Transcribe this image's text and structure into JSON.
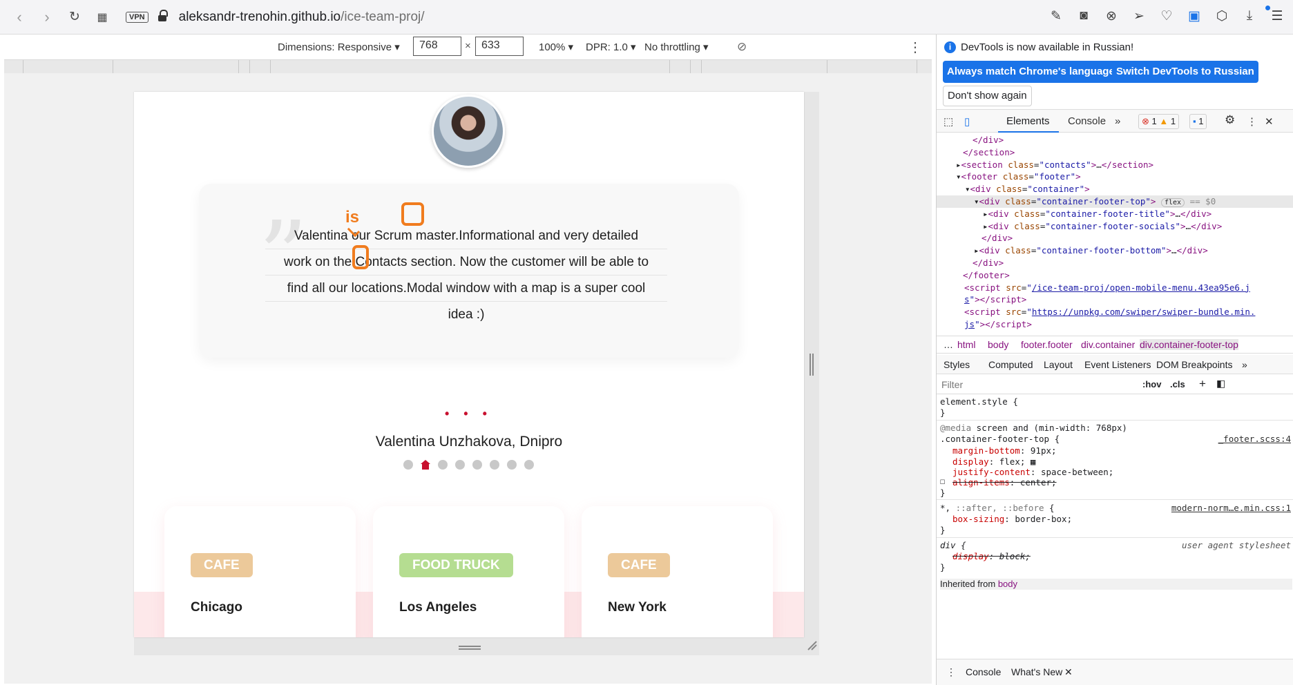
{
  "browser": {
    "vpn_label": "VPN",
    "url_domain": "aleksandr-trenohin.github.io",
    "url_path": "/ice-team-proj/"
  },
  "device_toolbar": {
    "dimensions": "Dimensions: Responsive ▾",
    "width": "768",
    "times": "×",
    "height": "633",
    "zoom": "100% ▾",
    "dpr": "DPR: 1.0 ▾",
    "throttling": "No throttling ▾"
  },
  "page": {
    "review_lines": [
      "Valentina our Scrum master.Informational and very detailed",
      "work on the Contacts section. Now the customer will be able to",
      "find all our locations.Modal window with a map is a super cool",
      "idea :)"
    ],
    "annotation": "is",
    "dots": "• • •",
    "author": "Valentina Unzhakova, Dnipro",
    "cards": [
      {
        "tag": "CAFE",
        "tag_color": "#ecc99a",
        "city": "Chicago"
      },
      {
        "tag": "FOOD TRUCK",
        "tag_color": "#b5dd91",
        "city": "Los Angeles"
      },
      {
        "tag": "CAFE",
        "tag_color": "#ecc99a",
        "city": "New York"
      }
    ]
  },
  "devtools": {
    "info_text": "DevTools is now available in Russian!",
    "btn_match": "Always match Chrome's language",
    "btn_switch": "Switch DevTools to Russian",
    "btn_dont_show": "Don't show again",
    "tab_elements": "Elements",
    "tab_console": "Console",
    "errors": "1",
    "warnings": "1",
    "messages": "1",
    "flex_badge": "flex",
    "dom_eq": "== $0",
    "breadcrumbs": [
      "html",
      "body",
      "footer.footer",
      "div.container",
      "div.container-footer-top"
    ],
    "style_tabs": [
      "Styles",
      "Computed",
      "Layout",
      "Event Listeners",
      "DOM Breakpoints"
    ],
    "filter_placeholder": "Filter",
    "hov": ":hov",
    "cls": ".cls",
    "inherited_from": "Inherited from",
    "inherited_el": "body",
    "drawer_console": "Console",
    "drawer_whats_new": "What's New"
  },
  "colors": {
    "accent_red": "#c8102e",
    "annotation_orange": "#f07c1e",
    "devtools_blue": "#1a73e8"
  }
}
